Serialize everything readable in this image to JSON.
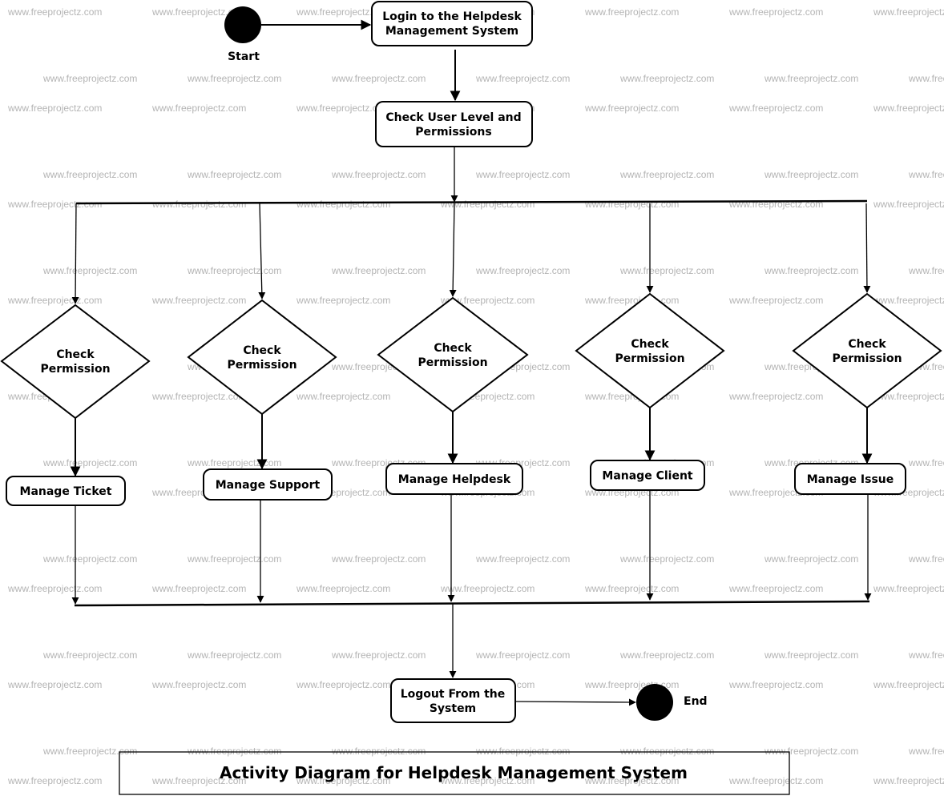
{
  "watermark": "www.freeprojectz.com",
  "start": {
    "label": "Start"
  },
  "end": {
    "label": "End"
  },
  "activities": {
    "login": [
      "Login to the Helpdesk",
      "Management System"
    ],
    "check_user": [
      "Check User Level and",
      "Permissions"
    ],
    "logout": [
      "Logout From the",
      "System"
    ]
  },
  "branches": [
    {
      "decision": [
        "Check",
        "Permission"
      ],
      "action": "Manage Ticket"
    },
    {
      "decision": [
        "Check",
        "Permission"
      ],
      "action": "Manage Support"
    },
    {
      "decision": [
        "Check",
        "Permission"
      ],
      "action": "Manage Helpdesk"
    },
    {
      "decision": [
        "Check",
        "Permission"
      ],
      "action": "Manage Client"
    },
    {
      "decision": [
        "Check",
        "Permission"
      ],
      "action": "Manage Issue"
    }
  ],
  "title": "Activity Diagram for Helpdesk Management System"
}
